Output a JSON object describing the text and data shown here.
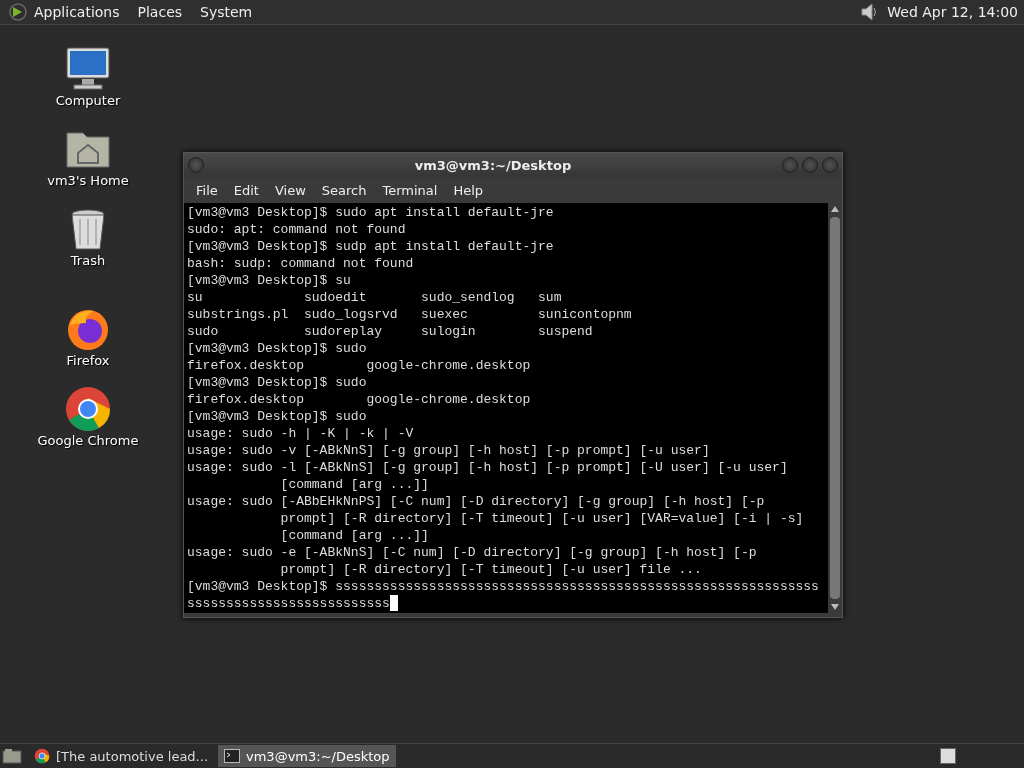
{
  "top_panel": {
    "menus": [
      "Applications",
      "Places",
      "System"
    ],
    "clock": "Wed Apr 12, 14:00"
  },
  "desktop_icons": [
    {
      "kind": "computer",
      "label": "Computer"
    },
    {
      "kind": "home",
      "label": "vm3's Home"
    },
    {
      "kind": "trash",
      "label": "Trash"
    },
    {
      "kind": "firefox",
      "label": "Firefox"
    },
    {
      "kind": "chrome",
      "label": "Google Chrome"
    }
  ],
  "window": {
    "title": "vm3@vm3:~/Desktop",
    "menu": [
      "File",
      "Edit",
      "View",
      "Search",
      "Terminal",
      "Help"
    ],
    "lines": [
      "[vm3@vm3 Desktop]$ sudo apt install default-jre",
      "sudo: apt: command not found",
      "[vm3@vm3 Desktop]$ sudp apt install default-jre",
      "bash: sudp: command not found",
      "[vm3@vm3 Desktop]$ su",
      "su             sudoedit       sudo_sendlog   sum",
      "substrings.pl  sudo_logsrvd   suexec         sunicontopnm",
      "sudo           sudoreplay     sulogin        suspend",
      "[vm3@vm3 Desktop]$ sudo",
      "firefox.desktop        google-chrome.desktop",
      "[vm3@vm3 Desktop]$ sudo",
      "firefox.desktop        google-chrome.desktop",
      "[vm3@vm3 Desktop]$ sudo",
      "usage: sudo -h | -K | -k | -V",
      "usage: sudo -v [-ABkNnS] [-g group] [-h host] [-p prompt] [-u user]",
      "usage: sudo -l [-ABkNnS] [-g group] [-h host] [-p prompt] [-U user] [-u user]",
      "            [command [arg ...]]",
      "usage: sudo [-ABbEHkNnPS] [-C num] [-D directory] [-g group] [-h host] [-p",
      "            prompt] [-R directory] [-T timeout] [-u user] [VAR=value] [-i | -s]",
      "            [command [arg ...]]",
      "usage: sudo -e [-ABkNnS] [-C num] [-D directory] [-g group] [-h host] [-p",
      "            prompt] [-R directory] [-T timeout] [-u user] file ...",
      "[vm3@vm3 Desktop]$ ssssssssssssssssssssssssssssssssssssssssssssssssssssssssssssss",
      "ssssssssssssssssssssssssss"
    ]
  },
  "taskbar": {
    "items": [
      {
        "kind": "chrome",
        "label": "[The automotive lead...",
        "selected": false
      },
      {
        "kind": "terminal",
        "label": "vm3@vm3:~/Desktop",
        "selected": true
      }
    ]
  }
}
